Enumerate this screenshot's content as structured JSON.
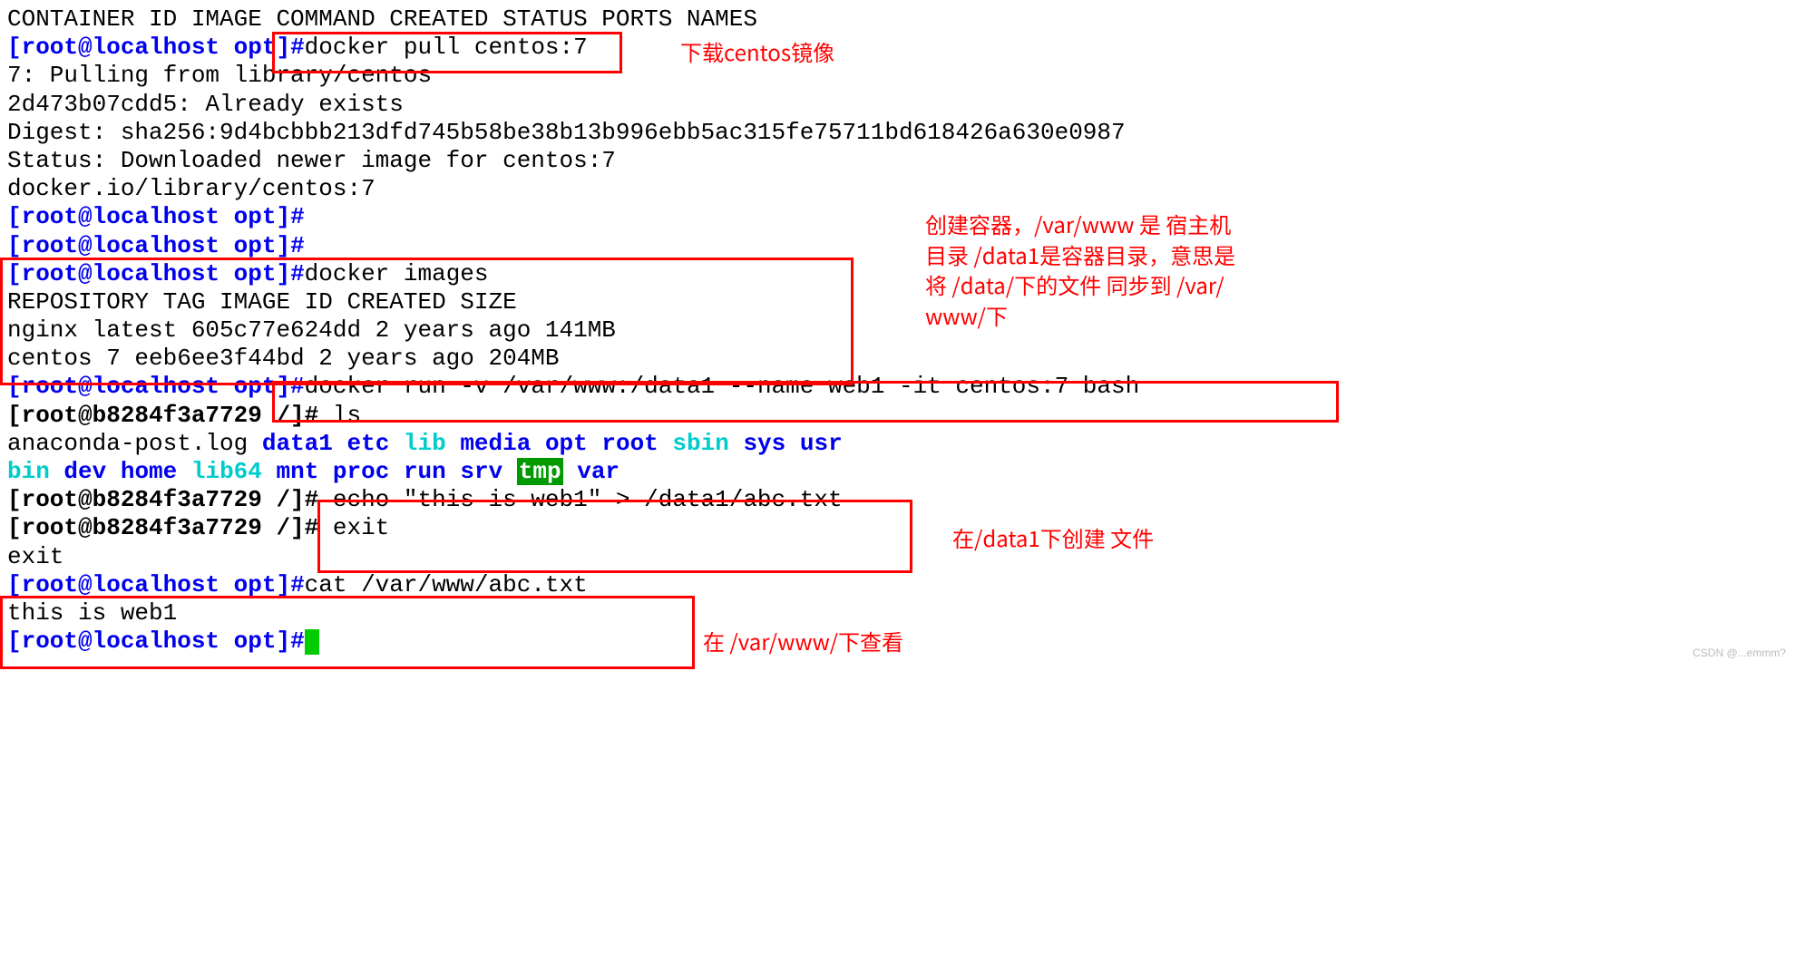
{
  "header": "CONTAINER ID   IMAGE     COMMAND   CREATED    STATUS    PORTS     NAMES",
  "prompt_host": "[root@localhost opt]",
  "prompt_cont": "[root@b8284f3a7729 /]# ",
  "cmd_pull": "docker pull centos:7",
  "pull_out_1": "7: Pulling from library/centos",
  "pull_out_2": "2d473b07cdd5: Already exists",
  "pull_out_3": "Digest: sha256:9d4bcbbb213dfd745b58be38b13b996ebb5ac315fe75711bd618426a630e0987",
  "pull_out_4": "Status: Downloaded newer image for centos:7",
  "pull_out_5": "docker.io/library/centos:7",
  "cmd_images": "docker images",
  "images_header": "REPOSITORY   TAG       IMAGE ID       CREATED       SIZE",
  "images_row1": "nginx        latest    605c77e624dd   2 years ago   141MB",
  "images_row2": "centos       7         eeb6ee3f44bd   2 years ago   204MB",
  "cmd_run": "docker run -v /var/www:/data1 --name web1 -it centos:7 bash",
  "cmd_ls": "ls",
  "ls_plain_1": "anaconda-post.log  ",
  "ls": {
    "data1": "data1",
    "etc": "etc",
    "lib": "lib",
    "media": "media",
    "opt": "opt",
    "root": "root",
    "sbin": "sbin",
    "sys": "sys",
    "usr": "usr",
    "bin": "bin",
    "dev": "dev",
    "home": "home",
    "lib64": "lib64",
    "mnt": "mnt",
    "proc": "proc",
    "run": "run",
    "srv": "srv",
    "tmp": "tmp",
    "var": "var"
  },
  "cmd_echo": "echo \"this is web1\" > /data1/abc.txt",
  "cmd_exit": "exit",
  "txt_exit": "exit",
  "cmd_cat": "cat /var/www/abc.txt",
  "cat_out": "this is web1",
  "ann": {
    "pull": "下载centos镜像",
    "run1": "创建容器，/var/www 是 宿主机",
    "run2": "目录 /data1是容器目录，意思是",
    "run3": "将 /data/下的文件 同步到 /var/",
    "run4": "www/下",
    "echo": "在/data1下创建 文件",
    "cat": "在 /var/www/下查看"
  },
  "watermark": "CSDN @...emmm?"
}
